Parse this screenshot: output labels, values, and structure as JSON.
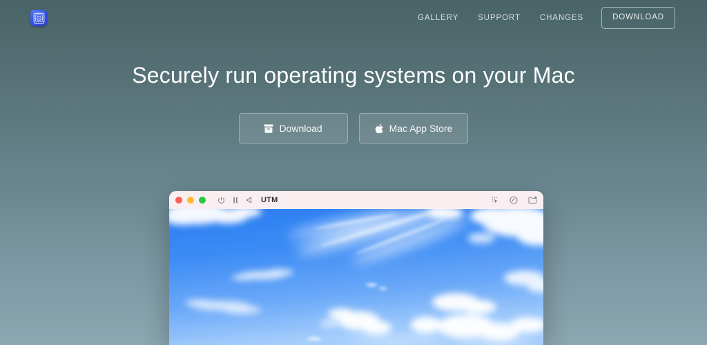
{
  "header": {
    "logo": {
      "icon": "utm-tunnel-logo-icon",
      "alt": "UTM"
    },
    "nav": [
      {
        "id": "gallery",
        "label": "GALLERY"
      },
      {
        "id": "support",
        "label": "SUPPORT"
      },
      {
        "id": "changes",
        "label": "CHANGES"
      }
    ],
    "cta": {
      "id": "download",
      "label": "DOWNLOAD"
    }
  },
  "hero": {
    "title": "Securely run operating systems on your Mac",
    "buttons": [
      {
        "id": "download",
        "label": "Download",
        "icon": "archive-box-icon"
      },
      {
        "id": "mac-app-store",
        "label": "Mac App Store",
        "icon": "apple-logo-icon",
        "glyph": ""
      }
    ]
  },
  "app_window": {
    "title": "UTM",
    "traffic_lights": [
      {
        "name": "close",
        "color": "#ff5f57"
      },
      {
        "name": "minimize",
        "color": "#febc2e"
      },
      {
        "name": "maximize",
        "color": "#28c840"
      }
    ],
    "toolbar_left": [
      {
        "id": "power",
        "icon": "power-icon"
      },
      {
        "id": "pause",
        "icon": "pause-icon"
      },
      {
        "id": "play",
        "icon": "play-triangle-icon"
      }
    ],
    "toolbar_right": [
      {
        "id": "capture-input",
        "icon": "cursor-sparkle-icon"
      },
      {
        "id": "drives",
        "icon": "disc-icon"
      },
      {
        "id": "shared-folder",
        "icon": "folder-badge-icon"
      }
    ],
    "screen_content": "Blue sky with white clouds desktop wallpaper"
  },
  "colors": {
    "bg_top": "#496467",
    "bg_bottom": "#8ba7b2",
    "titlebar": "#f9eff1",
    "sky": "#3d8cf5",
    "logo_blue": "#3556e8"
  }
}
